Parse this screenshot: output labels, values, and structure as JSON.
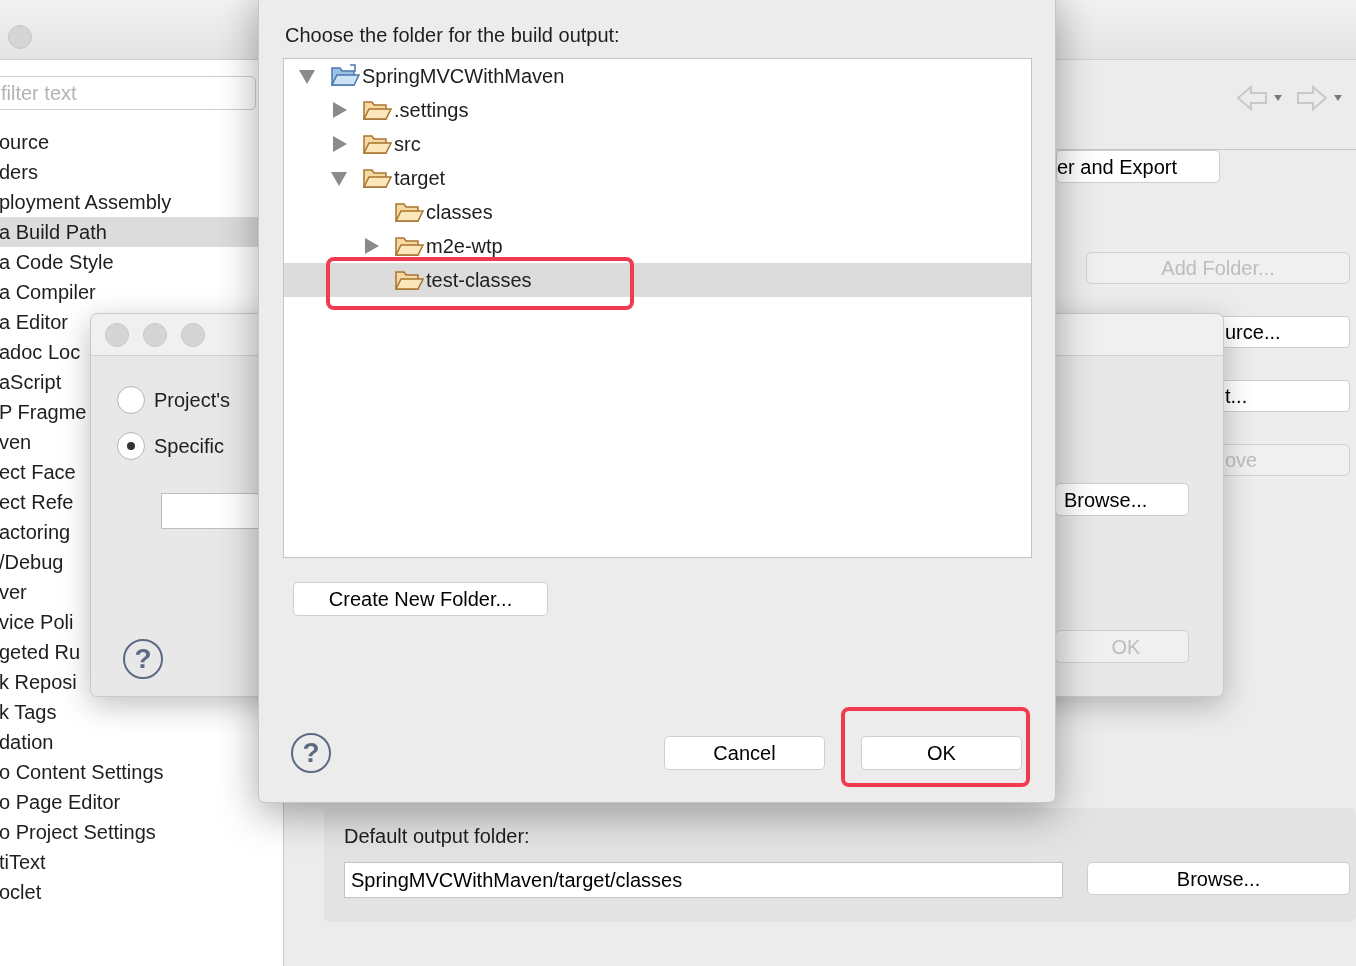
{
  "background_window": {
    "filter": {
      "placeholder": "filter text"
    },
    "sidebar": {
      "items": [
        {
          "label": "ource",
          "selected": false
        },
        {
          "label": "ders",
          "selected": false
        },
        {
          "label": "ployment Assembly",
          "selected": false
        },
        {
          "label": "a Build Path",
          "selected": true
        },
        {
          "label": "a Code Style",
          "selected": false
        },
        {
          "label": "a Compiler",
          "selected": false
        },
        {
          "label": "a Editor",
          "selected": false
        },
        {
          "label": "adoc Loc",
          "selected": false
        },
        {
          "label": "aScript",
          "selected": false
        },
        {
          "label": "P Fragme",
          "selected": false
        },
        {
          "label": "ven",
          "selected": false
        },
        {
          "label": "ect Face",
          "selected": false
        },
        {
          "label": "ect Refe",
          "selected": false
        },
        {
          "label": "actoring",
          "selected": false
        },
        {
          "label": "/Debug",
          "selected": false
        },
        {
          "label": "ver",
          "selected": false
        },
        {
          "label": "vice Poli",
          "selected": false
        },
        {
          "label": "geted Ru",
          "selected": false
        },
        {
          "label": "k Reposi",
          "selected": false
        },
        {
          "label": "k Tags",
          "selected": false
        },
        {
          "label": "dation",
          "selected": false
        },
        {
          "label": "o Content Settings",
          "selected": false
        },
        {
          "label": "o Page Editor",
          "selected": false
        },
        {
          "label": "o Project Settings",
          "selected": false
        },
        {
          "label": "tiText",
          "selected": false
        },
        {
          "label": "oclet",
          "selected": false
        }
      ]
    },
    "tab": {
      "label": "er and Export"
    },
    "side_buttons": [
      {
        "label": "Add Folder...",
        "kind": "whole",
        "disabled": true
      },
      {
        "label": "urce...",
        "kind": "covered",
        "disabled": false
      },
      {
        "label": "t...",
        "kind": "covered",
        "disabled": false
      },
      {
        "label": "ove",
        "kind": "covered",
        "disabled": true
      }
    ],
    "default_output": {
      "label": "Default output folder:",
      "value": "SpringMVCWithMaven/target/classes",
      "button": "Browse..."
    }
  },
  "source_dialog": {
    "options": [
      {
        "label": "Project's",
        "selected": false
      },
      {
        "label": "Specific",
        "selected": true
      }
    ],
    "help": "?",
    "buttons": [
      {
        "label": "Browse...",
        "disabled": false
      },
      {
        "label": "OK",
        "disabled": true
      }
    ]
  },
  "folder_dialog": {
    "prompt": "Choose the folder for the build output:",
    "tree": [
      {
        "label": "SpringMVCWithMaven",
        "kind": "project",
        "expanded": true,
        "selected": false,
        "highlighted": false,
        "children": [
          {
            "label": ".settings",
            "kind": "folder",
            "expanded": false,
            "selected": false,
            "highlighted": false
          },
          {
            "label": "src",
            "kind": "folder",
            "expanded": false,
            "selected": false,
            "highlighted": false
          },
          {
            "label": "target",
            "kind": "folder",
            "expanded": true,
            "selected": false,
            "highlighted": false,
            "children": [
              {
                "label": "classes",
                "kind": "folder",
                "selected": false,
                "highlighted": false
              },
              {
                "label": "m2e-wtp",
                "kind": "folder",
                "expanded": false,
                "selected": false,
                "highlighted": false
              },
              {
                "label": "test-classes",
                "kind": "folder",
                "selected": true,
                "highlighted": true
              }
            ]
          }
        ]
      }
    ],
    "new_folder_button": "Create New Folder...",
    "help": "?",
    "buttons": [
      {
        "label": "Cancel",
        "highlighted": false
      },
      {
        "label": "OK",
        "highlighted": true
      }
    ]
  }
}
